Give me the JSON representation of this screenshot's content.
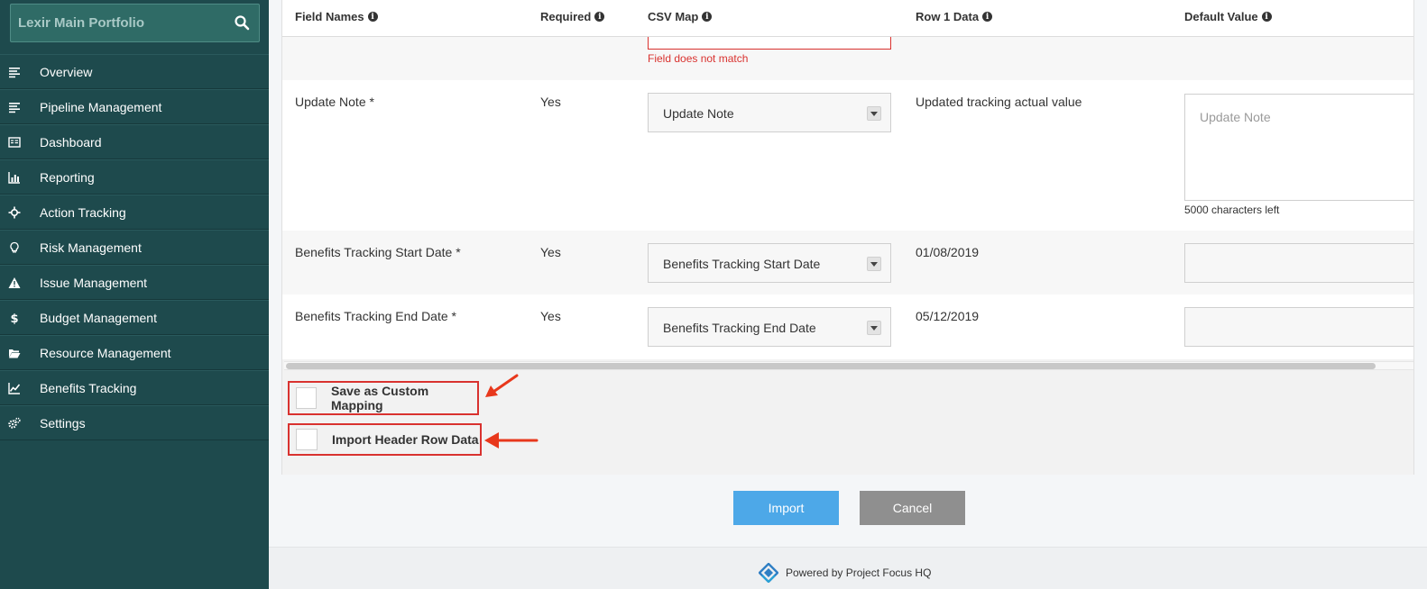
{
  "sidebar": {
    "portfolio_name": "Lexir Main Portfolio",
    "search_icon": "search-icon",
    "items": [
      {
        "label": "Overview",
        "icon": "list-icon"
      },
      {
        "label": "Pipeline Management",
        "icon": "list-icon"
      },
      {
        "label": "Dashboard",
        "icon": "dashboard-icon"
      },
      {
        "label": "Reporting",
        "icon": "bar-chart-icon"
      },
      {
        "label": "Action Tracking",
        "icon": "crosshair-icon"
      },
      {
        "label": "Risk Management",
        "icon": "lightbulb-icon"
      },
      {
        "label": "Issue Management",
        "icon": "warning-icon"
      },
      {
        "label": "Budget Management",
        "icon": "dollar-icon"
      },
      {
        "label": "Resource Management",
        "icon": "folder-open-icon"
      },
      {
        "label": "Benefits Tracking",
        "icon": "line-chart-icon"
      },
      {
        "label": "Settings",
        "icon": "gears-icon"
      }
    ]
  },
  "table": {
    "headers": {
      "field_names": "Field Names",
      "required": "Required",
      "csv_map": "CSV Map",
      "row1_data": "Row 1 Data",
      "default_value": "Default Value"
    },
    "error_text": "Field does not match",
    "rows": [
      {
        "field": "Update Note *",
        "required": "Yes",
        "csv_map": "Update Note",
        "row1": "Updated tracking actual value",
        "default_placeholder": "Update Note",
        "chars_left": "5000 characters left"
      },
      {
        "field": "Benefits Tracking Start Date *",
        "required": "Yes",
        "csv_map": "Benefits Tracking Start Date",
        "row1": "01/08/2019"
      },
      {
        "field": "Benefits Tracking End Date *",
        "required": "Yes",
        "csv_map": "Benefits Tracking End Date",
        "row1": "05/12/2019"
      }
    ]
  },
  "options": {
    "save_custom_mapping": "Save as Custom Mapping",
    "import_header_row": "Import Header Row Data"
  },
  "buttons": {
    "import": "Import",
    "cancel": "Cancel"
  },
  "footer": {
    "text": "Powered by Project Focus HQ"
  },
  "colors": {
    "sidebar_bg": "#1e4a4d",
    "accent_button": "#4da8e8",
    "cancel_button": "#8f8f8f",
    "highlight_red": "#d9322f"
  }
}
